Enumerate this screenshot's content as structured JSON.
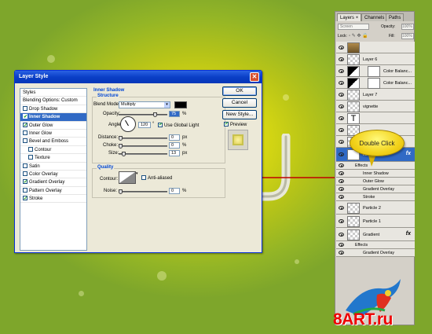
{
  "dialog": {
    "title": "Layer Style",
    "styles": [
      {
        "label": "Styles",
        "checkbox": false,
        "checked": false,
        "selected": false,
        "indent": false
      },
      {
        "label": "Blending Options: Custom",
        "checkbox": false,
        "checked": false,
        "selected": false,
        "indent": false
      },
      {
        "label": "Drop Shadow",
        "checkbox": true,
        "checked": false,
        "selected": false,
        "indent": false
      },
      {
        "label": "Inner Shadow",
        "checkbox": true,
        "checked": true,
        "selected": true,
        "indent": false
      },
      {
        "label": "Outer Glow",
        "checkbox": true,
        "checked": true,
        "selected": false,
        "indent": false
      },
      {
        "label": "Inner Glow",
        "checkbox": true,
        "checked": false,
        "selected": false,
        "indent": false
      },
      {
        "label": "Bevel and Emboss",
        "checkbox": true,
        "checked": false,
        "selected": false,
        "indent": false
      },
      {
        "label": "Contour",
        "checkbox": true,
        "checked": false,
        "selected": false,
        "indent": true
      },
      {
        "label": "Texture",
        "checkbox": true,
        "checked": false,
        "selected": false,
        "indent": true
      },
      {
        "label": "Satin",
        "checkbox": true,
        "checked": false,
        "selected": false,
        "indent": false
      },
      {
        "label": "Color Overlay",
        "checkbox": true,
        "checked": false,
        "selected": false,
        "indent": false
      },
      {
        "label": "Gradient Overlay",
        "checkbox": true,
        "checked": true,
        "selected": false,
        "indent": false
      },
      {
        "label": "Pattern Overlay",
        "checkbox": true,
        "checked": false,
        "selected": false,
        "indent": false
      },
      {
        "label": "Stroke",
        "checkbox": true,
        "checked": true,
        "selected": false,
        "indent": false
      }
    ],
    "section_title": "Inner Shadow",
    "structure": {
      "group_label": "Structure",
      "blend_mode_label": "Blend Mode:",
      "blend_mode_value": "Multiply",
      "shadow_color": "#000000",
      "opacity_label": "Opacity:",
      "opacity_value": "75",
      "opacity_unit": "%",
      "angle_label": "Angle:",
      "angle_value": "120",
      "angle_unit": "°",
      "global_light_label": "Use Global Light",
      "global_light_checked": true,
      "distance_label": "Distance:",
      "distance_value": "0",
      "distance_unit": "px",
      "choke_label": "Choke:",
      "choke_value": "0",
      "choke_unit": "%",
      "size_label": "Size:",
      "size_value": "13",
      "size_unit": "px"
    },
    "quality": {
      "group_label": "Quality",
      "contour_label": "Contour:",
      "anti_aliased_label": "Anti-aliased",
      "anti_aliased_checked": false,
      "noise_label": "Noise:",
      "noise_value": "0",
      "noise_unit": "%"
    },
    "buttons": {
      "ok": "OK",
      "cancel": "Cancel",
      "new_style": "New Style...",
      "preview_label": "Preview",
      "preview_checked": true
    }
  },
  "layers_panel": {
    "tabs": [
      "Layers",
      "Channels",
      "Paths"
    ],
    "tab_close": "×",
    "blend_mode": "Screen",
    "opacity_label": "Opacity:",
    "opacity_value": "100%",
    "lock_label": "Lock:",
    "fill_label": "Fill:",
    "fill_value": "100%",
    "layers": [
      {
        "name": "",
        "kind": "image"
      },
      {
        "name": "Layer 6",
        "kind": "layer"
      },
      {
        "name": "Color Balanc...",
        "kind": "adjust"
      },
      {
        "name": "Color Balanc...",
        "kind": "adjust"
      },
      {
        "name": "Layer 7",
        "kind": "layer"
      },
      {
        "name": "vignette",
        "kind": "layer"
      },
      {
        "name": "",
        "kind": "text"
      },
      {
        "name": "",
        "kind": "layer"
      },
      {
        "name": "",
        "kind": "layer"
      }
    ],
    "selected_layer": "RFMG",
    "selected_effects": [
      "Effects",
      "Inner Shadow",
      "Outer Glow",
      "Gradient Overlay",
      "Stroke"
    ],
    "lower_layers": [
      "Particle 2",
      "Particle 1",
      "Gradient"
    ],
    "gradient_effects": [
      "Effects",
      "Gradient Overlay"
    ],
    "fx_label": "fx"
  },
  "callout": {
    "text": "Double Click"
  },
  "watermark": "8ART.ru",
  "colors": {
    "accent": "#316ac5",
    "arrow": "#c00000",
    "callout": "#f2d21a"
  }
}
